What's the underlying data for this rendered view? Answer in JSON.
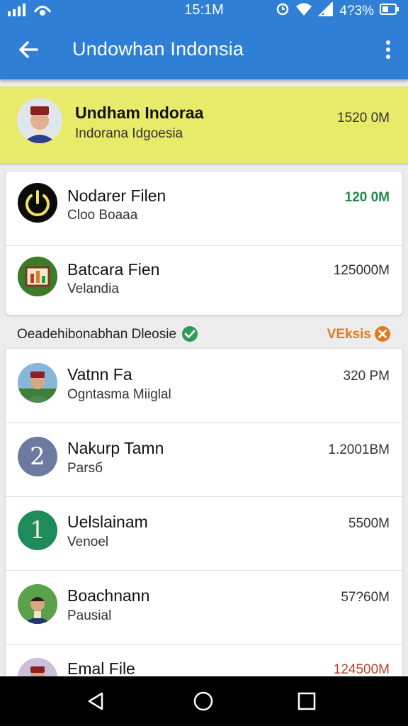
{
  "status": {
    "time": "15:1M",
    "battery": "4?3%"
  },
  "appbar": {
    "title": "Undowhan Indonsia"
  },
  "highlight": {
    "name": "Undham Indoraa",
    "sub": "Indorana Idgoesia",
    "time": "1520 0M"
  },
  "group1": [
    {
      "name": "Nodarer Filen",
      "sub": "Cloo Boaaa",
      "time": "120 0M",
      "time_color": "#1f8a4a"
    },
    {
      "name": "Batcara Fien",
      "sub": "Velandia",
      "time": "125000M",
      "time_color": "#333333"
    }
  ],
  "section": {
    "label": "Oeadehibonabhan Dleosie",
    "right_label": "VEksis",
    "check_color": "#2e9a52",
    "x_color": "#e07a1f"
  },
  "group2": [
    {
      "name": "Vatnn Fa",
      "sub": "Ogntasma Miiglal",
      "time": "320 PM"
    },
    {
      "name": "Nakurp Tamn",
      "sub": "Parsб",
      "time": "1.2001BM",
      "avatar_text": "2"
    },
    {
      "name": "Uelslainam",
      "sub": "Venoel",
      "time": "5500M",
      "avatar_text": "1"
    },
    {
      "name": "Boachnann",
      "sub": "Pausial",
      "time": "57?60M"
    },
    {
      "name": "Emal File",
      "sub": "",
      "time": "124500M"
    }
  ]
}
